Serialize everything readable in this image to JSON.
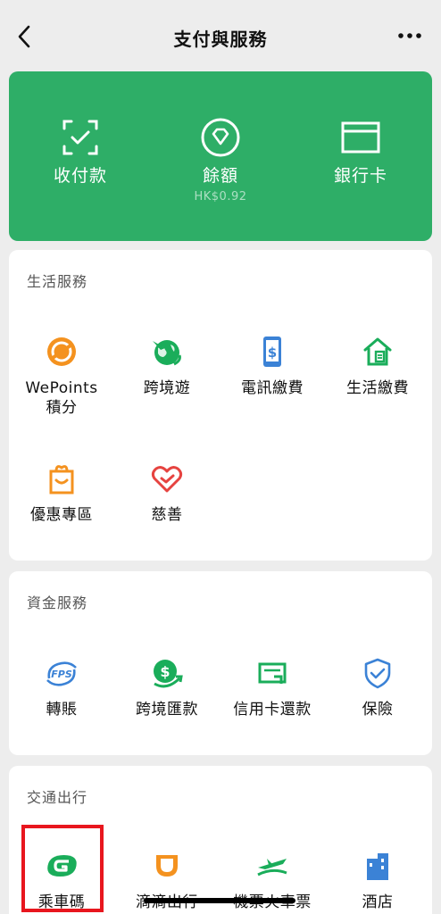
{
  "header": {
    "title": "支付與服務",
    "back_icon": "chevron-left-icon",
    "more_icon": "more-horizontal-icon"
  },
  "wallet": {
    "items": [
      {
        "label": "收付款",
        "icon": "scan-check-icon"
      },
      {
        "label": "餘額",
        "sub": "HK$0.92",
        "icon": "diamond-coin-icon"
      },
      {
        "label": "銀行卡",
        "icon": "bank-card-icon"
      }
    ],
    "color": "#2EAE67"
  },
  "life_services": {
    "title": "生活服務",
    "items": [
      {
        "label": "WePoints\n積分",
        "icon": "wepoints-icon"
      },
      {
        "label": "跨境遊",
        "icon": "globe-plane-icon"
      },
      {
        "label": "電訊繳費",
        "icon": "phone-dollar-icon"
      },
      {
        "label": "生活繳費",
        "icon": "house-bill-icon"
      },
      {
        "label": "優惠專區",
        "icon": "gift-bag-icon"
      },
      {
        "label": "慈善",
        "icon": "heart-hands-icon"
      }
    ]
  },
  "finance_services": {
    "title": "資金服務",
    "items": [
      {
        "label": "轉賬",
        "icon": "fps-icon"
      },
      {
        "label": "跨境匯款",
        "icon": "dollar-transfer-icon"
      },
      {
        "label": "信用卡還款",
        "icon": "credit-card-icon"
      },
      {
        "label": "保險",
        "icon": "shield-check-icon"
      }
    ]
  },
  "transport": {
    "title": "交通出行",
    "items": [
      {
        "label": "乘車碼",
        "icon": "ride-code-icon"
      },
      {
        "label": "滴滴出行",
        "icon": "didi-icon"
      },
      {
        "label": "機票火車票",
        "icon": "plane-train-icon"
      },
      {
        "label": "酒店",
        "icon": "hotel-building-icon"
      }
    ]
  }
}
